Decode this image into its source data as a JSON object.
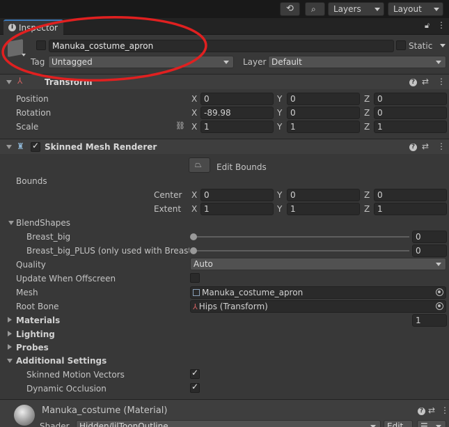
{
  "toolbar": {
    "layers_label": "Layers",
    "layout_label": "Layout"
  },
  "tab": {
    "title": "Inspector"
  },
  "object": {
    "name": "Manuka_costume_apron",
    "static_label": "Static",
    "tag_label": "Tag",
    "tag_value": "Untagged",
    "layer_label": "Layer",
    "layer_value": "Default"
  },
  "transform": {
    "title": "Transform",
    "rows": [
      {
        "label": "Position",
        "x": "0",
        "y": "0",
        "z": "0"
      },
      {
        "label": "Rotation",
        "x": "-89.98",
        "y": "0",
        "z": "0"
      },
      {
        "label": "Scale",
        "x": "1",
        "y": "1",
        "z": "1"
      }
    ],
    "axes": {
      "x": "X",
      "y": "Y",
      "z": "Z"
    }
  },
  "renderer": {
    "title": "Skinned Mesh Renderer",
    "edit_bounds": "Edit Bounds",
    "bounds_label": "Bounds",
    "center": {
      "label": "Center",
      "x": "0",
      "y": "0",
      "z": "0"
    },
    "extent": {
      "label": "Extent",
      "x": "1",
      "y": "1",
      "z": "1"
    },
    "blendshapes_label": "BlendShapes",
    "blendshapes": [
      {
        "label": "Breast_big",
        "value": "0",
        "level": 0
      },
      {
        "label": "Breast_big_PLUS (only used with Breast_b",
        "value": "0",
        "level": 0
      }
    ],
    "quality_label": "Quality",
    "quality_value": "Auto",
    "update_offscreen_label": "Update When Offscreen",
    "update_offscreen_checked": false,
    "mesh_label": "Mesh",
    "mesh_value": "Manuka_costume_apron",
    "root_bone_label": "Root Bone",
    "root_bone_value": "Hips (Transform)",
    "materials_label": "Materials",
    "materials_count": "1",
    "lighting_label": "Lighting",
    "probes_label": "Probes",
    "additional_label": "Additional Settings",
    "skinned_motion_label": "Skinned Motion Vectors",
    "skinned_motion_checked": true,
    "dynamic_occlusion_label": "Dynamic Occlusion",
    "dynamic_occlusion_checked": true
  },
  "material": {
    "title": "Manuka_costume (Material)",
    "shader_label": "Shader",
    "shader_value": "Hidden/lilToonOutline",
    "edit_label": "Edit..."
  },
  "colors": {
    "annotation": "#e02020",
    "accent": "#3a79bb"
  }
}
